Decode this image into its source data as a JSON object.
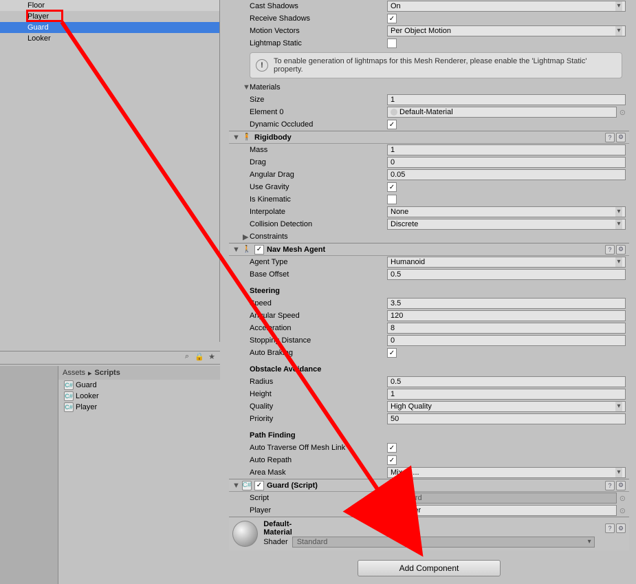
{
  "hierarchy": {
    "items": [
      {
        "name": "Floor"
      },
      {
        "name": "Player"
      },
      {
        "name": "Guard",
        "selected": true
      },
      {
        "name": "Looker"
      }
    ]
  },
  "project": {
    "breadcrumb": {
      "root": "Assets",
      "current": "Scripts"
    },
    "items": [
      {
        "name": "Guard"
      },
      {
        "name": "Looker"
      },
      {
        "name": "Player"
      }
    ],
    "toolbar_icons": [
      "lock-icon",
      "star-icon"
    ]
  },
  "inspector": {
    "meshRenderer": {
      "castShadows": {
        "label": "Cast Shadows",
        "value": "On"
      },
      "receiveShadows": {
        "label": "Receive Shadows",
        "checked": true
      },
      "motionVectors": {
        "label": "Motion Vectors",
        "value": "Per Object Motion"
      },
      "lightmapStatic": {
        "label": "Lightmap Static",
        "checked": false
      },
      "info": "To enable generation of lightmaps for this Mesh Renderer, please enable the 'Lightmap Static' property.",
      "materialsHeader": "Materials",
      "size": {
        "label": "Size",
        "value": "1"
      },
      "element0": {
        "label": "Element 0",
        "value": "Default-Material"
      },
      "dynamicOccluded": {
        "label": "Dynamic Occluded",
        "checked": true
      }
    },
    "rigidbody": {
      "title": "Rigidbody",
      "mass": {
        "label": "Mass",
        "value": "1"
      },
      "drag": {
        "label": "Drag",
        "value": "0"
      },
      "angularDrag": {
        "label": "Angular Drag",
        "value": "0.05"
      },
      "useGravity": {
        "label": "Use Gravity",
        "checked": true
      },
      "isKinematic": {
        "label": "Is Kinematic",
        "checked": false
      },
      "interpolate": {
        "label": "Interpolate",
        "value": "None"
      },
      "collisionDetection": {
        "label": "Collision Detection",
        "value": "Discrete"
      },
      "constraints": {
        "label": "Constraints"
      }
    },
    "navMeshAgent": {
      "title": "Nav Mesh Agent",
      "enabled": true,
      "agentType": {
        "label": "Agent Type",
        "value": "Humanoid"
      },
      "baseOffset": {
        "label": "Base Offset",
        "value": "0.5"
      },
      "steeringHeader": "Steering",
      "speed": {
        "label": "Speed",
        "value": "3.5"
      },
      "angularSpeed": {
        "label": "Angular Speed",
        "value": "120"
      },
      "acceleration": {
        "label": "Acceleration",
        "value": "8"
      },
      "stoppingDistance": {
        "label": "Stopping Distance",
        "value": "0"
      },
      "autoBraking": {
        "label": "Auto Braking",
        "checked": true
      },
      "obstacleHeader": "Obstacle Avoidance",
      "radius": {
        "label": "Radius",
        "value": "0.5"
      },
      "height": {
        "label": "Height",
        "value": "1"
      },
      "quality": {
        "label": "Quality",
        "value": "High Quality"
      },
      "priority": {
        "label": "Priority",
        "value": "50"
      },
      "pathHeader": "Path Finding",
      "autoTraverse": {
        "label": "Auto Traverse Off Mesh Link",
        "checked": true
      },
      "autoRepath": {
        "label": "Auto Repath",
        "checked": true
      },
      "areaMask": {
        "label": "Area Mask",
        "value": "Mixed ..."
      }
    },
    "guardScript": {
      "title": "Guard (Script)",
      "enabled": true,
      "script": {
        "label": "Script",
        "value": "Guard"
      },
      "player": {
        "label": "Player",
        "value": "Player"
      }
    },
    "material": {
      "name": "Default-Material",
      "shaderLabel": "Shader",
      "shaderValue": "Standard"
    },
    "addComponent": "Add Component"
  }
}
